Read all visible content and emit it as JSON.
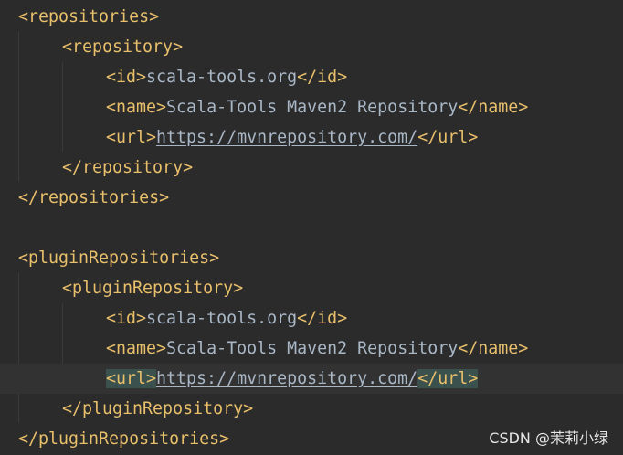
{
  "lines": [
    {
      "open": "<repositories>"
    },
    {
      "open": "<repository>"
    },
    {
      "open": "<id>",
      "value": "scala-tools.org",
      "close": "</id>"
    },
    {
      "open": "<name>",
      "value": "Scala-Tools Maven2 Repository",
      "close": "</name>"
    },
    {
      "open": "<url>",
      "value": "https://mvnrepository.com/",
      "close": "</url>"
    },
    {
      "open": "</repository>"
    },
    {
      "open": "</repositories>"
    },
    {
      "open": ""
    },
    {
      "open": "<pluginRepositories>"
    },
    {
      "open": "<pluginRepository>"
    },
    {
      "open": "<id>",
      "value": "scala-tools.org",
      "close": "</id>"
    },
    {
      "open": "<name>",
      "value": "Scala-Tools Maven2 Repository",
      "close": "</name>"
    },
    {
      "open": "<url>",
      "value": "https://mvnrepository.com/",
      "close": "</url>"
    },
    {
      "open": "</pluginRepository>"
    },
    {
      "open": "</pluginRepositories>"
    }
  ],
  "watermark": "CSDN @茉莉小绿",
  "colors": {
    "background": "#2b2b2b",
    "tag": "#e8bf6a",
    "text": "#a9b7c6",
    "current_line": "#323232",
    "matched_tag_highlight": "#3b514d"
  }
}
